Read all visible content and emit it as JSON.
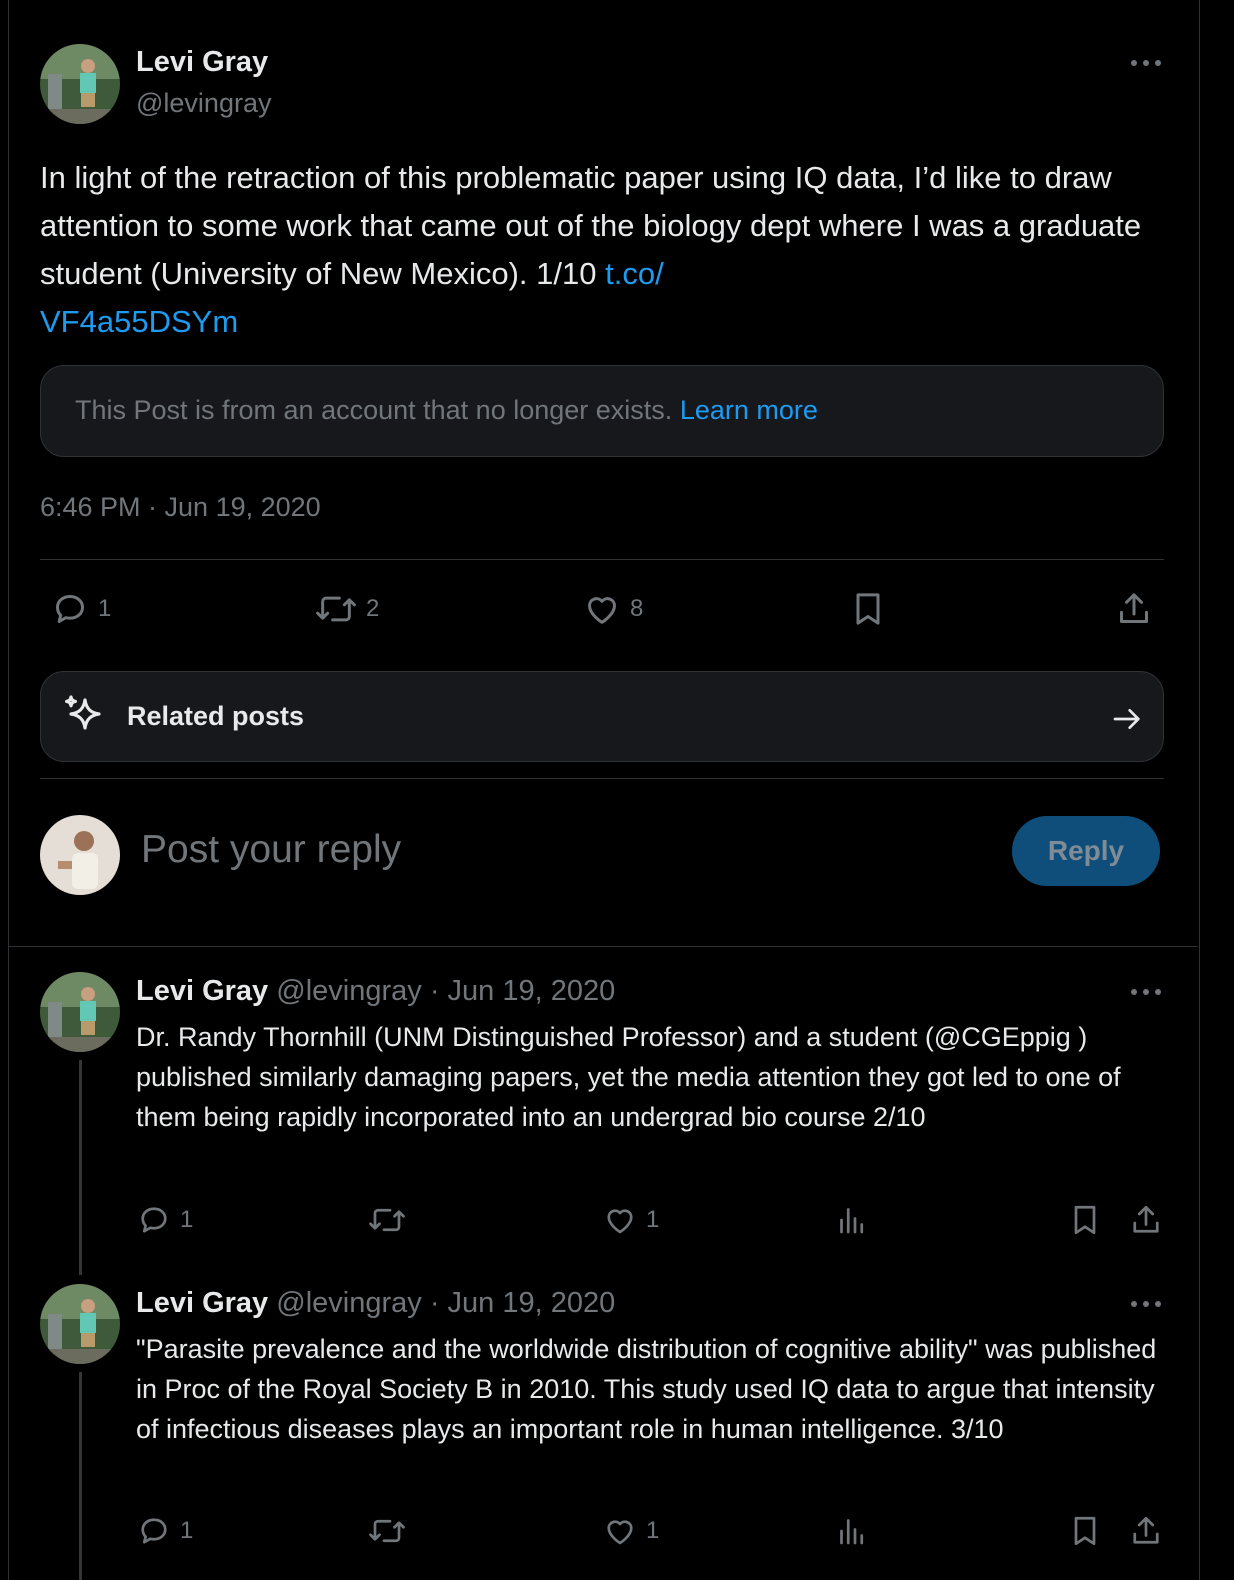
{
  "main_post": {
    "author_name": "Levi Gray",
    "author_handle": "@levingray",
    "text": "In light of the retraction of this problematic paper using IQ data, I’d like to draw attention to some work that came out of the biology dept where I was a graduate student (University of New Mexico). 1/10 ",
    "link_text": "t.co/\nVF4a55DSYm",
    "quote_notice": "This Post is from an account that no longer exists.",
    "learn_more": "Learn more",
    "timestamp": "6:46 PM · Jun 19, 2020",
    "replies": "1",
    "reposts": "2",
    "likes": "8"
  },
  "related": {
    "label": "Related posts"
  },
  "composer": {
    "placeholder": "Post your reply",
    "reply_button": "Reply"
  },
  "thread": [
    {
      "author_name": "Levi Gray",
      "author_handle": "@levingray",
      "date": "· Jun 19, 2020",
      "text": "Dr. Randy Thornhill (UNM Distinguished Professor) and a student (@CGEppig ) published similarly damaging papers, yet the media attention they got led to one of them being rapidly incorporated into an undergrad bio course 2/10",
      "replies": "1",
      "likes": "1"
    },
    {
      "author_name": "Levi Gray",
      "author_handle": "@levingray",
      "date": "· Jun 19, 2020",
      "text": "\"Parasite prevalence and the worldwide distribution of cognitive ability\" was published in Proc of the Royal Society B in 2010. This study used IQ data to argue that intensity of infectious diseases plays an important role in human intelligence. 3/10",
      "replies": "1",
      "likes": "1"
    }
  ],
  "colors": {
    "accent": "#1d9bf0",
    "reply_button": "#0f4e7a",
    "muted": "#71767b",
    "border": "#2f3336"
  },
  "icons": [
    "more-icon",
    "reply-icon",
    "repost-icon",
    "like-icon",
    "bookmark-icon",
    "share-icon",
    "sparkle-icon",
    "arrow-right-icon",
    "views-icon"
  ]
}
